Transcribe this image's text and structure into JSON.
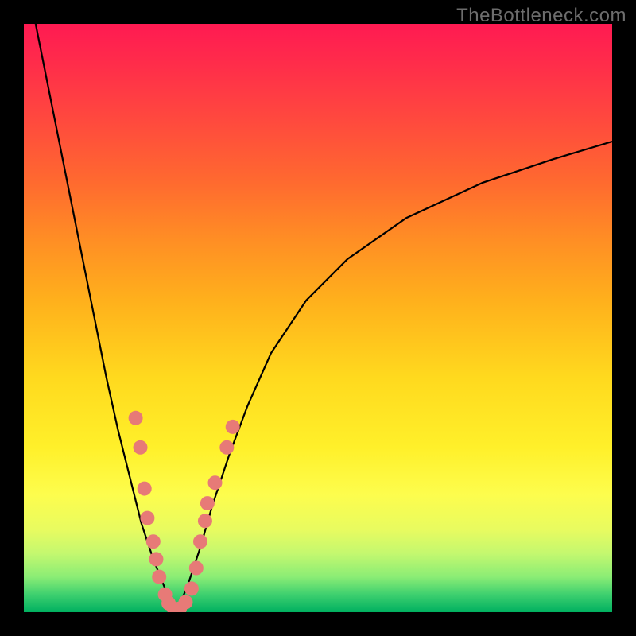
{
  "watermark": "TheBottleneck.com",
  "chart_data": {
    "type": "line",
    "title": "",
    "xlabel": "",
    "ylabel": "",
    "xlim": [
      0,
      100
    ],
    "ylim": [
      0,
      100
    ],
    "grid": false,
    "legend": false,
    "curve_left": {
      "description": "descending V-branch (left)",
      "x": [
        2,
        4,
        6,
        8,
        10,
        12,
        14,
        16,
        18,
        20,
        22,
        24,
        25,
        26
      ],
      "y": [
        100,
        90,
        80,
        70,
        60,
        50,
        40,
        31,
        23,
        15,
        9,
        4,
        1.5,
        0
      ]
    },
    "curve_right": {
      "description": "ascending V-branch (right)",
      "x": [
        26,
        28,
        30,
        32,
        35,
        38,
        42,
        48,
        55,
        65,
        78,
        90,
        100
      ],
      "y": [
        0,
        5,
        11,
        18,
        27,
        35,
        44,
        53,
        60,
        67,
        73,
        77,
        80
      ]
    },
    "markers": {
      "description": "salmon dots clustered near the V-bottom on both branches",
      "color": "#e77a77",
      "radius_px": 9,
      "points": [
        {
          "x": 19.0,
          "y": 33.0
        },
        {
          "x": 19.8,
          "y": 28.0
        },
        {
          "x": 20.5,
          "y": 21.0
        },
        {
          "x": 21.0,
          "y": 16.0
        },
        {
          "x": 22.0,
          "y": 12.0
        },
        {
          "x": 22.5,
          "y": 9.0
        },
        {
          "x": 23.0,
          "y": 6.0
        },
        {
          "x": 24.0,
          "y": 3.0
        },
        {
          "x": 24.6,
          "y": 1.5
        },
        {
          "x": 25.5,
          "y": 0.6
        },
        {
          "x": 26.5,
          "y": 0.6
        },
        {
          "x": 27.5,
          "y": 1.7
        },
        {
          "x": 28.5,
          "y": 4.0
        },
        {
          "x": 29.3,
          "y": 7.5
        },
        {
          "x": 30.0,
          "y": 12.0
        },
        {
          "x": 30.8,
          "y": 15.5
        },
        {
          "x": 31.2,
          "y": 18.5
        },
        {
          "x": 32.5,
          "y": 22.0
        },
        {
          "x": 34.5,
          "y": 28.0
        },
        {
          "x": 35.5,
          "y": 31.5
        }
      ]
    }
  },
  "colors": {
    "background": "#000000",
    "curve": "#000000",
    "marker": "#e77a77"
  }
}
